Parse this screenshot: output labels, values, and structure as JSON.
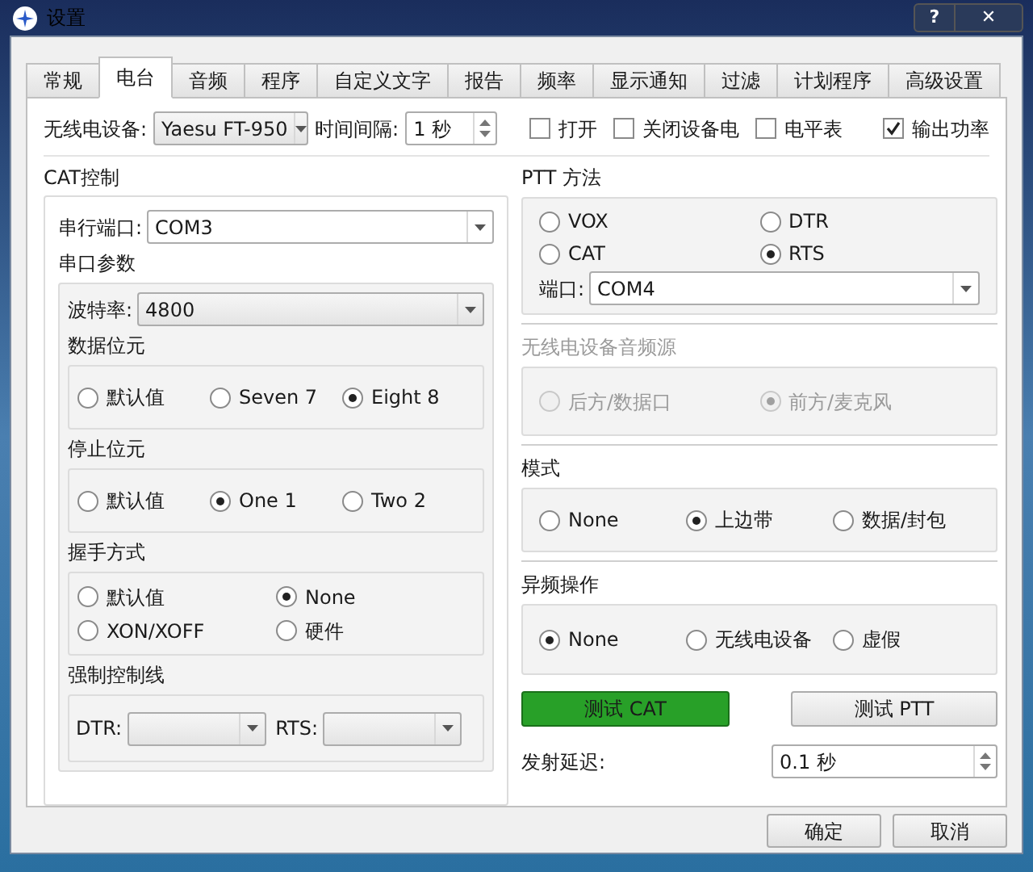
{
  "window": {
    "title": "设置",
    "help": "?",
    "close": "✕"
  },
  "tabs": [
    {
      "label": "常规",
      "selected": false
    },
    {
      "label": "电台",
      "selected": true
    },
    {
      "label": "音频",
      "selected": false
    },
    {
      "label": "程序",
      "selected": false
    },
    {
      "label": "自定义文字",
      "selected": false
    },
    {
      "label": "报告",
      "selected": false
    },
    {
      "label": "频率",
      "selected": false
    },
    {
      "label": "显示通知",
      "selected": false
    },
    {
      "label": "过滤",
      "selected": false
    },
    {
      "label": "计划程序",
      "selected": false
    },
    {
      "label": "高级设置",
      "selected": false
    }
  ],
  "top_row": {
    "rig": {
      "label": "无线电设备:",
      "value": "Yaesu FT-950"
    },
    "interval": {
      "label": "时间间隔:",
      "value": "1 秒"
    },
    "checkboxes": [
      {
        "label": "打开",
        "checked": false
      },
      {
        "label": "关闭设备电",
        "checked": false
      },
      {
        "label": "电平表",
        "checked": false
      },
      {
        "label": "输出功率",
        "checked": true
      }
    ]
  },
  "cat": {
    "title": "CAT控制",
    "serial_port": {
      "label": "串行端口:",
      "value": "COM3"
    },
    "params_title": "串口参数",
    "baud": {
      "label": "波特率:",
      "value": "4800"
    },
    "groups": [
      {
        "title": "数据位元",
        "options": [
          {
            "label": "默认值",
            "selected": false
          },
          {
            "label": "Seven 7",
            "selected": false
          },
          {
            "label": "Eight 8",
            "selected": true
          }
        ]
      },
      {
        "title": "停止位元",
        "options": [
          {
            "label": "默认值",
            "selected": false
          },
          {
            "label": "One 1",
            "selected": true
          },
          {
            "label": "Two 2",
            "selected": false
          }
        ]
      }
    ],
    "handshake": {
      "title": "握手方式",
      "options": [
        {
          "label": "默认值",
          "selected": false
        },
        {
          "label": "None",
          "selected": true
        },
        {
          "label": "XON/XOFF",
          "selected": false
        },
        {
          "label": "硬件",
          "selected": false
        }
      ]
    },
    "force_lines": {
      "title": "强制控制线",
      "dtr_label": "DTR:",
      "rts_label": "RTS:"
    }
  },
  "ptt": {
    "title": "PTT 方法",
    "options": [
      {
        "label": "VOX",
        "selected": false
      },
      {
        "label": "DTR",
        "selected": false
      },
      {
        "label": "CAT",
        "selected": false
      },
      {
        "label": "RTS",
        "selected": true
      }
    ],
    "port": {
      "label": "端口:",
      "value": "COM4"
    }
  },
  "audio_source": {
    "title": "无线电设备音频源",
    "disabled": true,
    "options": [
      {
        "label": "后方/数据口",
        "selected": false
      },
      {
        "label": "前方/麦克风",
        "selected": true
      }
    ]
  },
  "mode": {
    "title": "模式",
    "options": [
      {
        "label": "None",
        "selected": false
      },
      {
        "label": "上边带",
        "selected": true
      },
      {
        "label": "数据/封包",
        "selected": false
      }
    ]
  },
  "split": {
    "title": "异频操作",
    "options": [
      {
        "label": "None",
        "selected": true
      },
      {
        "label": "无线电设备",
        "selected": false
      },
      {
        "label": "虚假",
        "selected": false
      }
    ]
  },
  "test_cat": {
    "label": "测试 CAT",
    "ok": true
  },
  "test_ptt": {
    "label": "测试 PTT"
  },
  "tx_delay": {
    "label": "发射延迟:",
    "value": "0.1 秒"
  },
  "buttons": [
    "确定",
    "取消"
  ]
}
